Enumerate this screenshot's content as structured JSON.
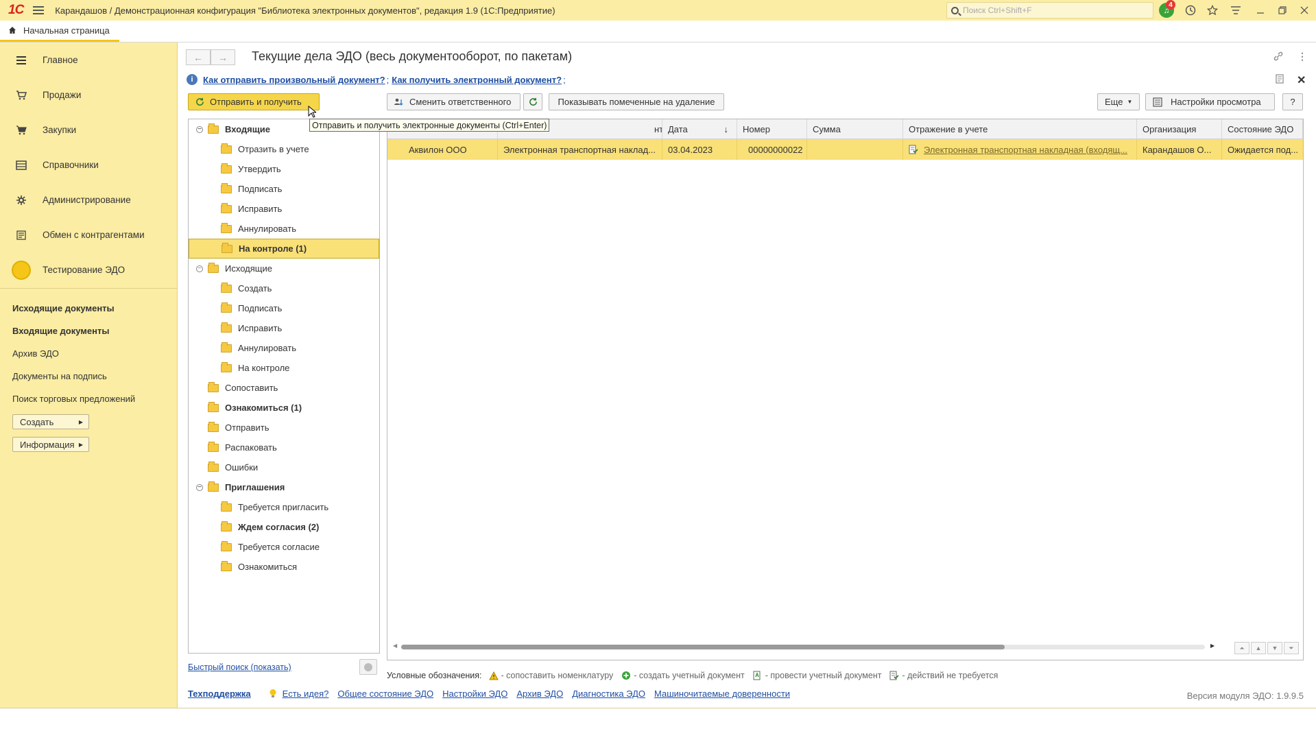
{
  "window": {
    "logo": "1С",
    "title": "Карандашов / Демонстрационная конфигурация \"Библиотека электронных документов\", редакция 1.9  (1С:Предприятие)",
    "search_placeholder": "Поиск Ctrl+Shift+F",
    "notification_count": "4"
  },
  "tabs": {
    "home": "Начальная страница"
  },
  "sidebar": {
    "sections": [
      {
        "label": "Главное",
        "icon": "menu-icon"
      },
      {
        "label": "Продажи",
        "icon": "sales-icon"
      },
      {
        "label": "Закупки",
        "icon": "purchases-icon"
      },
      {
        "label": "Справочники",
        "icon": "catalogs-icon"
      },
      {
        "label": "Администрирование",
        "icon": "gear-icon"
      },
      {
        "label": "Обмен с контрагентами",
        "icon": "exchange-icon"
      },
      {
        "label": "Тестирование ЭДО",
        "icon": "circle-icon"
      }
    ],
    "links": [
      {
        "label": "Исходящие документы",
        "bold": true
      },
      {
        "label": "Входящие документы",
        "bold": true
      },
      {
        "label": "Архив ЭДО",
        "bold": false
      },
      {
        "label": "Документы на подпись",
        "bold": false
      },
      {
        "label": "Поиск торговых предложений",
        "bold": false
      }
    ],
    "buttons": [
      "Создать",
      "Информация"
    ]
  },
  "form": {
    "title": "Текущие дела ЭДО (весь документооборот, по пакетам)",
    "help_link_1": "Как отправить произвольный документ?",
    "help_link_2": "Как получить электронный документ?",
    "sep": ";",
    "btn_send_receive": "Отправить и получить",
    "btn_change_responsible": "Сменить ответственного",
    "btn_show_deleted": "Показывать помеченные на удаление",
    "btn_more": "Еще",
    "btn_view_settings": "Настройки просмотра",
    "btn_help": "?",
    "tooltip": "Отправить и получить электронные документы (Ctrl+Enter)"
  },
  "tree": [
    {
      "label": "Входящие",
      "level": 0,
      "bold": true,
      "expand": true
    },
    {
      "label": "Отразить в учете",
      "level": 1
    },
    {
      "label": "Утвердить",
      "level": 1
    },
    {
      "label": "Подписать",
      "level": 1
    },
    {
      "label": "Исправить",
      "level": 1
    },
    {
      "label": "Аннулировать",
      "level": 1
    },
    {
      "label": "На контроле (1)",
      "level": 1,
      "bold": true,
      "selected": true
    },
    {
      "label": "Исходящие",
      "level": 0,
      "expand": true
    },
    {
      "label": "Создать",
      "level": 1
    },
    {
      "label": "Подписать",
      "level": 1
    },
    {
      "label": "Исправить",
      "level": 1
    },
    {
      "label": "Аннулировать",
      "level": 1
    },
    {
      "label": "На контроле",
      "level": 1
    },
    {
      "label": "Сопоставить",
      "level": 0
    },
    {
      "label": "Ознакомиться (1)",
      "level": 0,
      "bold": true
    },
    {
      "label": "Отправить",
      "level": 0
    },
    {
      "label": "Распаковать",
      "level": 0
    },
    {
      "label": "Ошибки",
      "level": 0
    },
    {
      "label": "Приглашения",
      "level": 0,
      "bold": true,
      "expand": true
    },
    {
      "label": "Требуется пригласить",
      "level": 1
    },
    {
      "label": "Ждем согласия (2)",
      "level": 1,
      "bold": true
    },
    {
      "label": "Требуется согласие",
      "level": 1
    },
    {
      "label": "Ознакомиться",
      "level": 1
    }
  ],
  "grid": {
    "columns": [
      "",
      "нта",
      "Дата",
      "Номер",
      "Сумма",
      "Отражение в учете",
      "Организация",
      "Состояние ЭДО"
    ],
    "sort_indicator": "↓",
    "rows": [
      {
        "counterparty": "Аквилон ООО",
        "doc_type": "Электронная транспортная наклад...",
        "date": "03.04.2023",
        "number": "00000000022",
        "sum": "",
        "accounting": "Электронная транспортная накладная (входящ...",
        "organization": "Карандашов О...",
        "status": "Ожидается под..."
      }
    ]
  },
  "quick_search": "Быстрый поиск (показать)",
  "legend": {
    "title": "Условные обозначения:",
    "items": [
      {
        "text": "- сопоставить номенклатуру",
        "icon": "warning-icon"
      },
      {
        "text": "- создать учетный документ",
        "icon": "plus-icon"
      },
      {
        "text": "- провести учетный документ",
        "icon": "post-doc-icon"
      },
      {
        "text": "- действий не требуется",
        "icon": "no-action-icon"
      }
    ]
  },
  "footer": {
    "support": "Техподдержка",
    "links": [
      "Есть идея?",
      "Общее состояние ЭДО",
      "Настройки ЭДО",
      "Архив ЭДО",
      "Диагностика ЭДО",
      "Машиночитаемые доверенности"
    ],
    "version": "Версия модуля ЭДО: 1.9.9.5"
  }
}
